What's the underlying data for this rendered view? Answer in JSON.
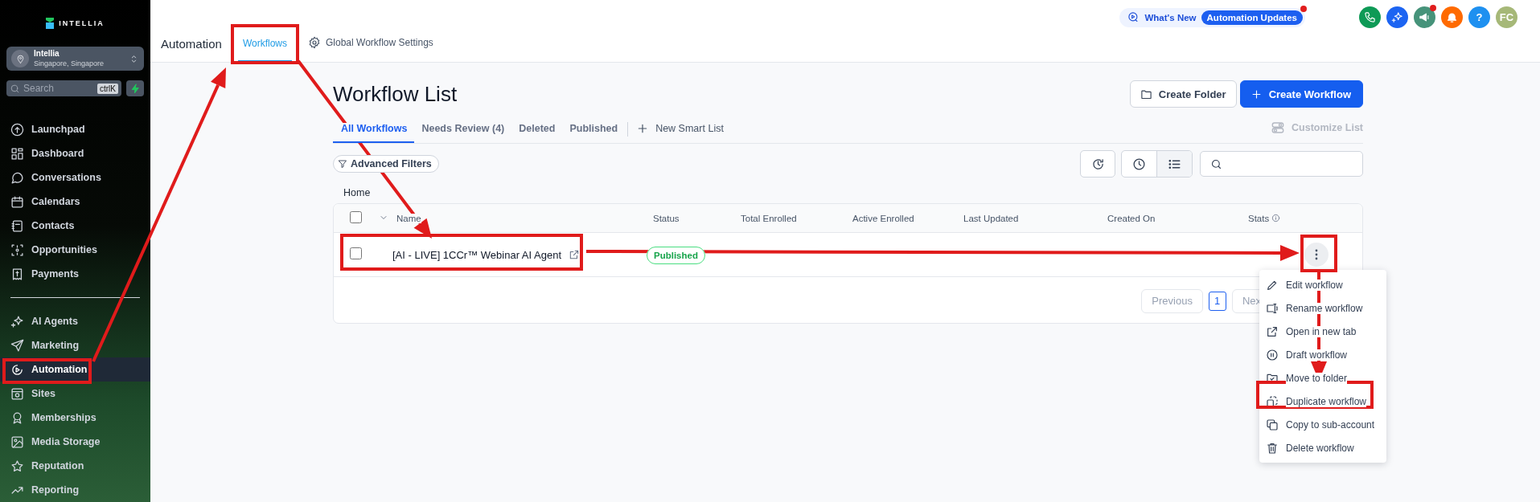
{
  "sidebar": {
    "logo": "INTELLIA",
    "account": {
      "name": "Intellia",
      "location": "Singapore, Singapore"
    },
    "search": {
      "placeholder": "Search",
      "shortcut": "ctrlK"
    },
    "nav_groups": [
      {
        "items": [
          {
            "label": "Launchpad",
            "selected": false
          },
          {
            "label": "Dashboard",
            "selected": false
          },
          {
            "label": "Conversations",
            "selected": false
          },
          {
            "label": "Calendars",
            "selected": false
          },
          {
            "label": "Contacts",
            "selected": false
          },
          {
            "label": "Opportunities",
            "selected": false
          },
          {
            "label": "Payments",
            "selected": false
          }
        ]
      },
      {
        "items": [
          {
            "label": "AI Agents",
            "selected": false
          },
          {
            "label": "Marketing",
            "selected": false
          },
          {
            "label": "Automation",
            "selected": true
          },
          {
            "label": "Sites",
            "selected": false
          },
          {
            "label": "Memberships",
            "selected": false
          },
          {
            "label": "Media Storage",
            "selected": false
          },
          {
            "label": "Reputation",
            "selected": false
          },
          {
            "label": "Reporting",
            "selected": false
          }
        ]
      }
    ]
  },
  "header": {
    "title": "Automation",
    "tabs": [
      {
        "label": "Workflows",
        "selected": true
      },
      {
        "label": "Global Workflow Settings",
        "selected": false
      }
    ],
    "whats_new": {
      "label": "What's New",
      "badge": "Automation Updates",
      "unread": true
    },
    "actions": [
      {
        "kind": "phone",
        "unread": false
      },
      {
        "kind": "ai",
        "unread": false
      },
      {
        "kind": "announce",
        "unread": true
      },
      {
        "kind": "bell",
        "unread": false
      },
      {
        "kind": "help",
        "label": "?",
        "unread": false
      },
      {
        "kind": "avatar",
        "label": "FC",
        "unread": false
      }
    ]
  },
  "page": {
    "title": "Workflow List",
    "buttons": [
      {
        "label": "Create Folder",
        "primary": false
      },
      {
        "label": "Create Workflow",
        "primary": true
      }
    ],
    "list_tabs": [
      {
        "label": "All Workflows",
        "selected": true
      },
      {
        "label": "Needs Review (4)",
        "selected": false
      },
      {
        "label": "Deleted",
        "selected": false
      },
      {
        "label": "Published",
        "selected": false
      }
    ],
    "new_smart_list": "New Smart List",
    "customize": {
      "label": "Customize List",
      "disabled": true
    },
    "filters": "Advanced Filters",
    "views": [
      {
        "selected": false
      },
      {
        "selected": true
      }
    ],
    "breadcrumb": "Home",
    "table": {
      "all_checked": false,
      "columns": [
        "Name",
        "Status",
        "Total Enrolled",
        "Active Enrolled",
        "Last Updated",
        "Created On",
        "Stats"
      ],
      "rows": [
        {
          "name": "[AI - LIVE] 1CCr™ Webinar AI Agent",
          "status": "Published",
          "checked": false
        }
      ]
    },
    "pagination": {
      "previous": "Previous",
      "pages": [
        {
          "label": "1",
          "selected": true
        }
      ],
      "next": "Nex"
    },
    "menu": [
      "Edit workflow",
      "Rename workflow",
      "Open in new tab",
      "Draft workflow",
      "Move to folder",
      "Duplicate workflow",
      "Copy to sub-account",
      "Delete workflow"
    ]
  }
}
